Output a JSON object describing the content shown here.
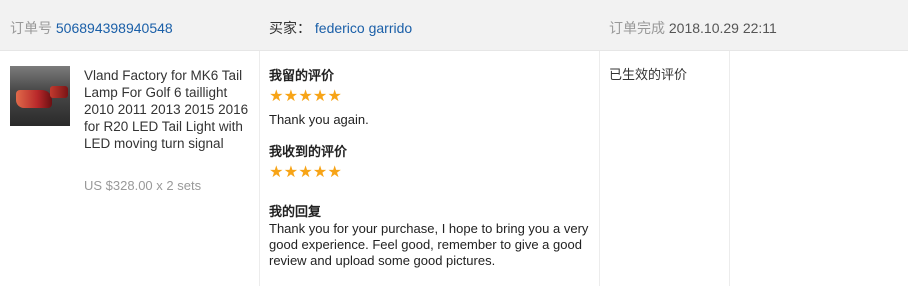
{
  "header": {
    "order_label": "订单号",
    "order_number": "506894398940548",
    "buyer_label": "买家：",
    "buyer_name": "federico garrido",
    "status_label": "订单完成",
    "status_time": "2018.10.29 22:11"
  },
  "product": {
    "image_icon": "tail-light-photo",
    "title": "Vland Factory for MK6 Tail Lamp For Golf 6 taillight 2010 2011 2013 2015 2016 for R20 LED Tail Light with LED moving turn signal",
    "price": "US $328.00 x 2 sets"
  },
  "feedback": {
    "left": {
      "title": "我留的评价",
      "stars": 5,
      "text": "Thank you again."
    },
    "received": {
      "title": "我收到的评价",
      "stars": 5
    },
    "reply": {
      "title": "我的回复",
      "text": "Thank you for your purchase, I hope to bring you a very good experience. Feel good, remember to give a good review and upload some good pictures."
    }
  },
  "status_column": {
    "text": "已生效的评价"
  },
  "colors": {
    "header_bg": "#f2f2f2",
    "link": "#1a5fa8",
    "star": "#f7a417",
    "muted": "#999999"
  }
}
